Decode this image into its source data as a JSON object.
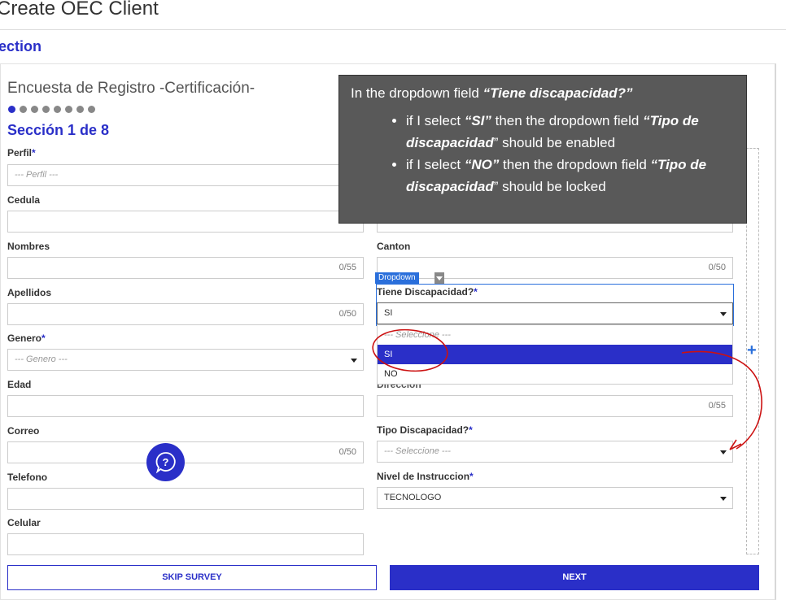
{
  "header": {
    "title": "Create OEC Client",
    "section_tab": "ection"
  },
  "survey": {
    "title": "Encuesta de Registro -Certificación-",
    "dots_total": 8,
    "dots_active": 1,
    "section_label": "Sección 1 de 8"
  },
  "fields": {
    "perfil": {
      "label": "Perfil",
      "req": "*",
      "placeholder": "--- Perfil ---"
    },
    "cedula": {
      "label": "Cedula"
    },
    "nombres": {
      "label": "Nombres",
      "counter": "0/55"
    },
    "apellidos": {
      "label": "Apellidos",
      "counter": "0/50"
    },
    "genero": {
      "label": "Genero",
      "req": "*",
      "placeholder": "--- Genero ---"
    },
    "edad": {
      "label": "Edad"
    },
    "correo": {
      "label": "Correo",
      "counter": "0/50"
    },
    "telefono": {
      "label": "Telefono"
    },
    "celular": {
      "label": "Celular"
    },
    "canton": {
      "label": "Canton",
      "counter": "0/50"
    },
    "tiene_discapacidad": {
      "label": "Tiene Discapacidad?",
      "req": "*",
      "value": "SI"
    },
    "direccion": {
      "label": "Direccion",
      "counter": "0/55"
    },
    "tipo_discapacidad": {
      "label": "Tipo Discapacidad?",
      "req": "*",
      "placeholder": "--- Seleccione ---"
    },
    "nivel_instruccion": {
      "label": "Nivel de Instruccion",
      "req": "*",
      "value": "TECNOLOGO"
    }
  },
  "dropdown": {
    "badge": "Dropdown",
    "options": [
      "--- Seleccione ---",
      "SI",
      "NO"
    ],
    "selected": "SI"
  },
  "callout": {
    "intro_prefix": "In the dropdown field ",
    "intro_field": "“Tiene discapacidad?”",
    "b1_a": "if I select ",
    "b1_val": "“SI”",
    "b1_b": " then the dropdown field ",
    "b1_field": "“Tipo de discapacidad",
    "b1_c": "” should be enabled",
    "b2_a": "if  I select ",
    "b2_val": "“NO”",
    "b2_b": " then the dropdown field ",
    "b2_field": "“Tipo de discapacidad",
    "b2_c": "” should be locked"
  },
  "buttons": {
    "skip": "SKIP SURVEY",
    "next": "NEXT",
    "add": "+"
  },
  "colors": {
    "accent": "#2a2fc8",
    "callout_bg": "#595959",
    "annotation_red": "#cc1111"
  }
}
